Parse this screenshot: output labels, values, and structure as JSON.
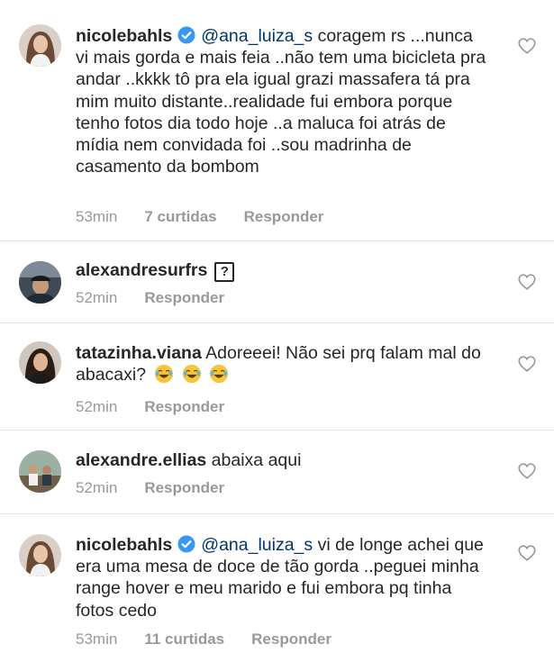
{
  "comments": [
    {
      "username": "nicolebahls",
      "verified": true,
      "mention": "@ana_luiza_s",
      "text": " coragem rs ...nunca vi mais gorda e mais feia ..não tem uma bicicleta pra andar ..kkkk tô pra ela igual grazi massafera tá pra mim muito distante..realidade fui embora porque tenho fotos dia todo hoje ..a maluca foi atrás de mídia nem convidada foi ..sou madrinha de casamento da bombom",
      "time": "53min",
      "likes": "7 curtidas",
      "reply": "Responder",
      "avatar": "woman-long-hair"
    },
    {
      "username": "alexandresurfrs",
      "suffix_icon": "?",
      "text": "",
      "time": "52min",
      "reply": "Responder",
      "avatar": "man-cap-car"
    },
    {
      "username": "tatazinha.viana",
      "text": " Adoreeei! Não sei prq falam mal do abacaxi?",
      "emojis": [
        "😂",
        "😂",
        "😂"
      ],
      "time": "52min",
      "reply": "Responder",
      "avatar": "woman-dark-hair"
    },
    {
      "username": "alexandre.ellias",
      "text": " abaixa aqui",
      "time": "52min",
      "reply": "Responder",
      "avatar": "people-outdoor"
    },
    {
      "username": "nicolebahls",
      "verified": true,
      "mention": "@ana_luiza_s",
      "text": " vi de longe achei que era uma mesa de doce de tão gorda ..peguei minha range hover e meu marido e fui embora pq tinha fotos cedo",
      "time": "53min",
      "likes": "11 curtidas",
      "reply": "Responder",
      "avatar": "woman-long-hair"
    }
  ],
  "colors": {
    "text": "#262626",
    "mention": "#003569",
    "meta": "#999999",
    "verified": "#3897f0",
    "divider": "#e6e6e6"
  }
}
